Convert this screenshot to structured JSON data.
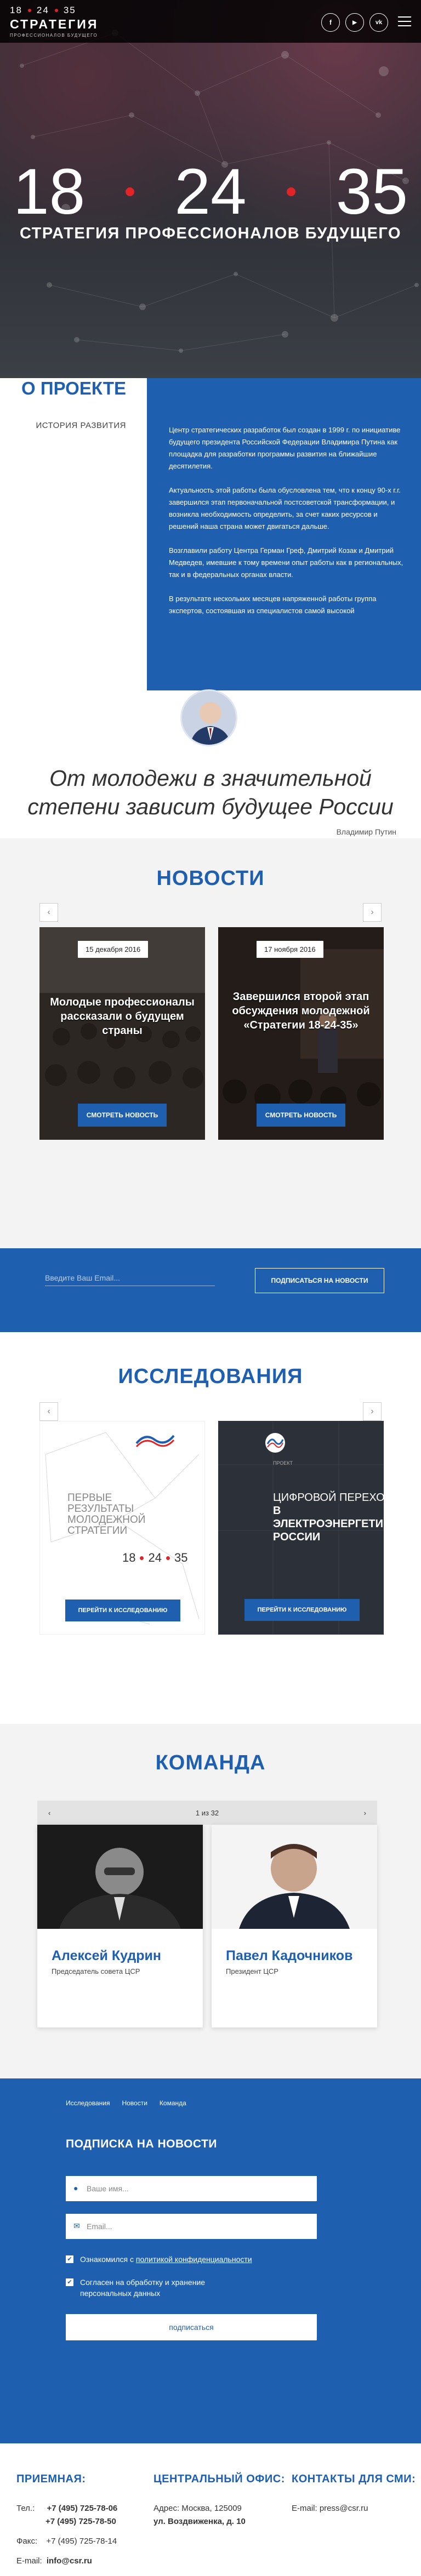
{
  "header": {
    "logo_nums": [
      "18",
      "24",
      "35"
    ],
    "logo_word": "СТРАТЕГИЯ",
    "logo_sub": "ПРОФЕССИОНАЛОВ БУДУЩЕГО",
    "socials": [
      {
        "icon": "facebook-icon",
        "glyph": "f"
      },
      {
        "icon": "youtube-icon",
        "glyph": "▶"
      },
      {
        "icon": "vk-icon",
        "glyph": "vk"
      }
    ]
  },
  "hero": {
    "nums": [
      "18",
      "24",
      "35"
    ],
    "subtitle": "СТРАТЕГИЯ ПРОФЕССИОНАЛОВ БУДУЩЕГО"
  },
  "about": {
    "title": "О ПРОЕКТЕ",
    "subtitle": "ИСТОРИЯ РАЗВИТИЯ",
    "paragraphs": [
      "Центр стратегических разработок был создан в 1999 г. по инициативе будущего президента Российской Федерации Владимира Путина как площадка для разработки программы развития на ближайшие десятилетия.",
      "Актуальность этой работы была обусловлена тем, что к концу 90-х г.г. завершился этап первоначальной постсоветской трансформации, и возникла необходимость определить, за счет каких ресурсов и решений наша страна может двигаться дальше.",
      "Возглавили работу Центра Герман Греф, Дмитрий Козак и Дмитрий Медведев, имевшие к тому времени опыт работы как в региональных, так и в федеральных органах власти.",
      "В результате нескольких месяцев напряженной работы группа экспертов, состоявшая из специалистов самой высокой"
    ]
  },
  "quote": {
    "text": "От молодежи в значительной степени зависит будущее России",
    "author": "Владимир Путин"
  },
  "news": {
    "title": "НОВОСТИ",
    "items": [
      {
        "date": "15 декабря 2016",
        "title": "Молодые профессионалы рассказали о будущем страны",
        "button": "СМОТРЕТЬ НОВОСТЬ"
      },
      {
        "date": "17 ноября 2016",
        "title": "Завершился второй этап обсуждения молодежной «Стратегии 18-24-35»",
        "button": "СМОТРЕТЬ НОВОСТЬ"
      }
    ]
  },
  "subscribe_band": {
    "email_placeholder": "Введите Ваш Email...",
    "button": "ПОДПИСАТЬСЯ НА НОВОСТИ"
  },
  "research": {
    "title": "ИССЛЕДОВАНИЯ",
    "items": [
      {
        "cover_lines": [
          "ПЕРВЫЕ",
          "РЕЗУЛЬТАТЫ",
          "МОЛОДЕЖНОЙ",
          "СТРАТЕГИИ"
        ],
        "cover_nums": [
          "18",
          "24",
          "35"
        ],
        "button": "ПЕРЕЙТИ К ИССЛЕДОВАНИЮ"
      },
      {
        "cover_top": "ПРОЕКТ",
        "cover_lines": [
          "ЦИФРОВОЙ ПЕРЕХОД",
          "В ЭЛЕКТРОЭНЕРГЕТИКЕ",
          "РОССИИ"
        ],
        "button": "ПЕРЕЙТИ К ИССЛЕДОВАНИЮ"
      }
    ]
  },
  "team": {
    "title": "КОМАНДА",
    "pager": "1 из 32",
    "members": [
      {
        "name": "Алексей Кудрин",
        "role": "Председатель совета ЦСР"
      },
      {
        "name": "Павел Кадочников",
        "role": "Президент ЦСР"
      }
    ]
  },
  "form": {
    "nav": [
      "Исследования",
      "Новости",
      "Команда"
    ],
    "title": "ПОДПИСКА НА НОВОСТИ",
    "name_placeholder": "Ваше имя...",
    "email_placeholder": "Email...",
    "consent_prefix": "Ознакомился с ",
    "consent_link": "политикой конфиденциальности",
    "consent2": "Согласен на обработку и хранение персональных данных",
    "button": "подписаться"
  },
  "footer": {
    "reception": {
      "title": "ПРИЕМНАЯ:",
      "tel_label": "Тел.:",
      "tel1": "+7 (495) 725-78-06",
      "tel2": "+7 (495) 725-78-50",
      "fax_label": "Факс:",
      "fax": "+7 (495) 725-78-14",
      "email_label": "E-mail:",
      "email": "info@csr.ru"
    },
    "office": {
      "title": "ЦЕНТРАЛЬНЫЙ ОФИС:",
      "addr_label": "Адрес: Москва, 125009",
      "addr_street": "ул. Воздвиженка, д. 10"
    },
    "smi": {
      "title": "КОНТАКТЫ ДЛЯ СМИ:",
      "email_label": "E-mail: ",
      "email": "press@csr.ru"
    }
  },
  "colors": {
    "brand_blue": "#1f5fb0",
    "accent_red": "#e02428",
    "dark": "#2f3037"
  }
}
